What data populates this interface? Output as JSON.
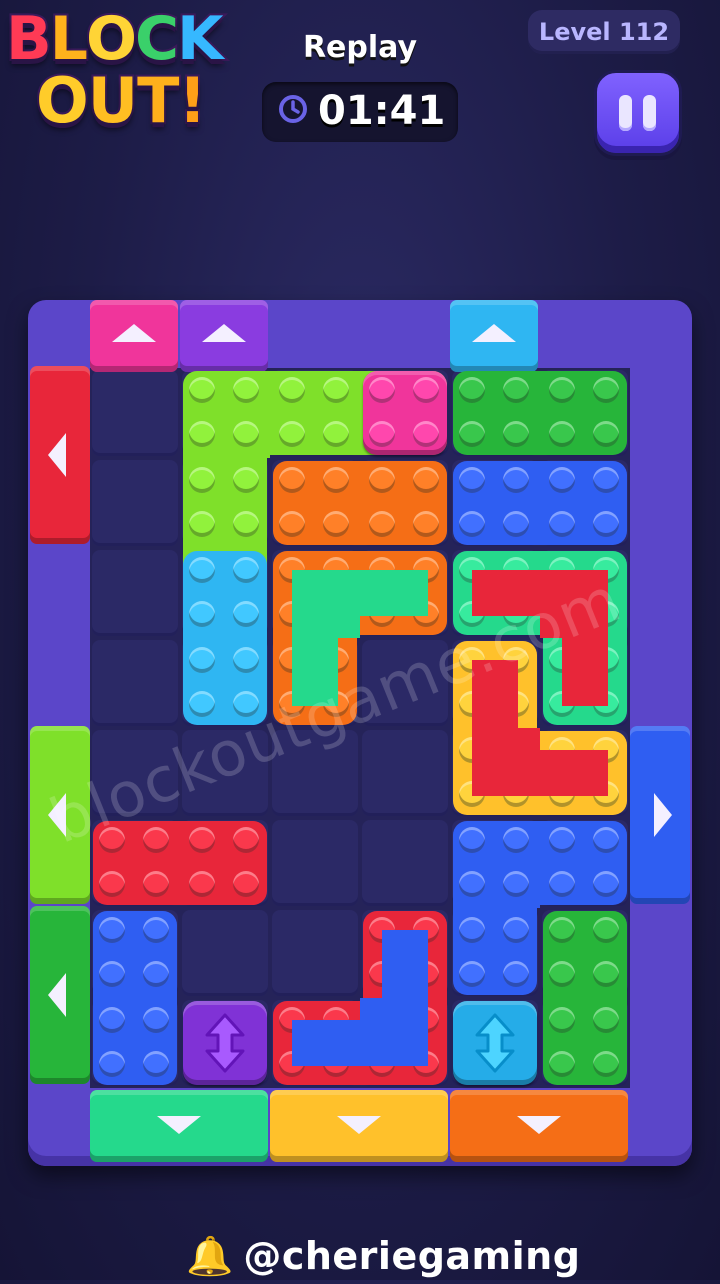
{
  "game": {
    "logo": {
      "line1": "BLOCK",
      "line2": "OUT!"
    },
    "mode_label": "Replay",
    "timer": "01:41",
    "level": "Level 112",
    "watermark": "blockoutgame.com",
    "credit": "@cheriegaming"
  },
  "icons": {
    "timer": "clock-icon",
    "pause": "pause-icon",
    "credit": "bell-icon",
    "door": "triangle-arrow-icon",
    "vertical_mover": "up-down-arrow-icon"
  },
  "colors": {
    "background": "#1d1c47",
    "frame": "#5b46c9",
    "pink": "#f0359b",
    "lime": "#7fe02a",
    "green": "#27b53a",
    "orange": "#f56e16",
    "blue": "#2f5ef2",
    "cyan": "#2fb6f2",
    "mint": "#25d98c",
    "yellow": "#ffc12b",
    "red": "#e8263a",
    "purple": "#8a3ce0"
  },
  "board": {
    "cols": 6,
    "rows": 8
  },
  "doors": [
    {
      "side": "top",
      "color": "pink",
      "columns": [
        0
      ]
    },
    {
      "side": "top",
      "color": "purple",
      "columns": [
        1
      ]
    },
    {
      "side": "top",
      "color": "cyan",
      "columns": [
        4
      ]
    },
    {
      "side": "left",
      "color": "red",
      "rows": [
        0,
        1
      ]
    },
    {
      "side": "left",
      "color": "lime",
      "rows": [
        4,
        5
      ]
    },
    {
      "side": "left",
      "color": "green",
      "rows": [
        6,
        7
      ]
    },
    {
      "side": "right",
      "color": "blue",
      "rows": [
        4,
        5
      ]
    },
    {
      "side": "bottom",
      "color": "mint",
      "columns": [
        0,
        1
      ]
    },
    {
      "side": "bottom",
      "color": "yellow",
      "columns": [
        2,
        3
      ]
    },
    {
      "side": "bottom",
      "color": "orange",
      "columns": [
        4,
        5
      ]
    }
  ],
  "blocks": [
    {
      "color": "lime",
      "cells": [
        [
          1,
          0
        ],
        [
          2,
          0
        ],
        [
          3,
          0
        ],
        [
          1,
          1
        ],
        [
          1,
          2
        ]
      ]
    },
    {
      "color": "pink",
      "cells": [
        [
          3,
          0
        ]
      ]
    },
    {
      "color": "green",
      "cells": [
        [
          4,
          0
        ],
        [
          5,
          0
        ]
      ]
    },
    {
      "color": "orange",
      "cells": [
        [
          2,
          1
        ],
        [
          3,
          1
        ]
      ]
    },
    {
      "color": "blue",
      "cells": [
        [
          4,
          1
        ],
        [
          5,
          1
        ]
      ]
    },
    {
      "color": "cyan",
      "cells": [
        [
          1,
          2
        ],
        [
          1,
          3
        ]
      ]
    },
    {
      "color": "orange",
      "cells": [
        [
          2,
          2
        ],
        [
          3,
          2
        ],
        [
          2,
          3
        ]
      ],
      "inner": "mint"
    },
    {
      "color": "mint",
      "cells": [
        [
          4,
          2
        ],
        [
          5,
          2
        ],
        [
          5,
          3
        ]
      ],
      "inner": "red"
    },
    {
      "color": "yellow",
      "cells": [
        [
          4,
          3
        ],
        [
          4,
          4
        ],
        [
          5,
          4
        ]
      ],
      "inner": "red"
    },
    {
      "color": "red",
      "cells": [
        [
          0,
          5
        ],
        [
          1,
          5
        ]
      ]
    },
    {
      "color": "blue",
      "cells": [
        [
          4,
          5
        ],
        [
          5,
          5
        ],
        [
          4,
          6
        ]
      ]
    },
    {
      "color": "blue",
      "cells": [
        [
          0,
          6
        ],
        [
          0,
          7
        ]
      ]
    },
    {
      "color": "red",
      "cells": [
        [
          3,
          6
        ],
        [
          2,
          7
        ],
        [
          3,
          7
        ]
      ],
      "inner": "blue"
    },
    {
      "color": "green",
      "cells": [
        [
          5,
          6
        ],
        [
          5,
          7
        ]
      ]
    },
    {
      "color": "purple",
      "cells": [
        [
          1,
          7
        ]
      ],
      "mover": "vertical"
    },
    {
      "color": "cyan",
      "cells": [
        [
          4,
          7
        ]
      ],
      "mover": "vertical"
    }
  ]
}
